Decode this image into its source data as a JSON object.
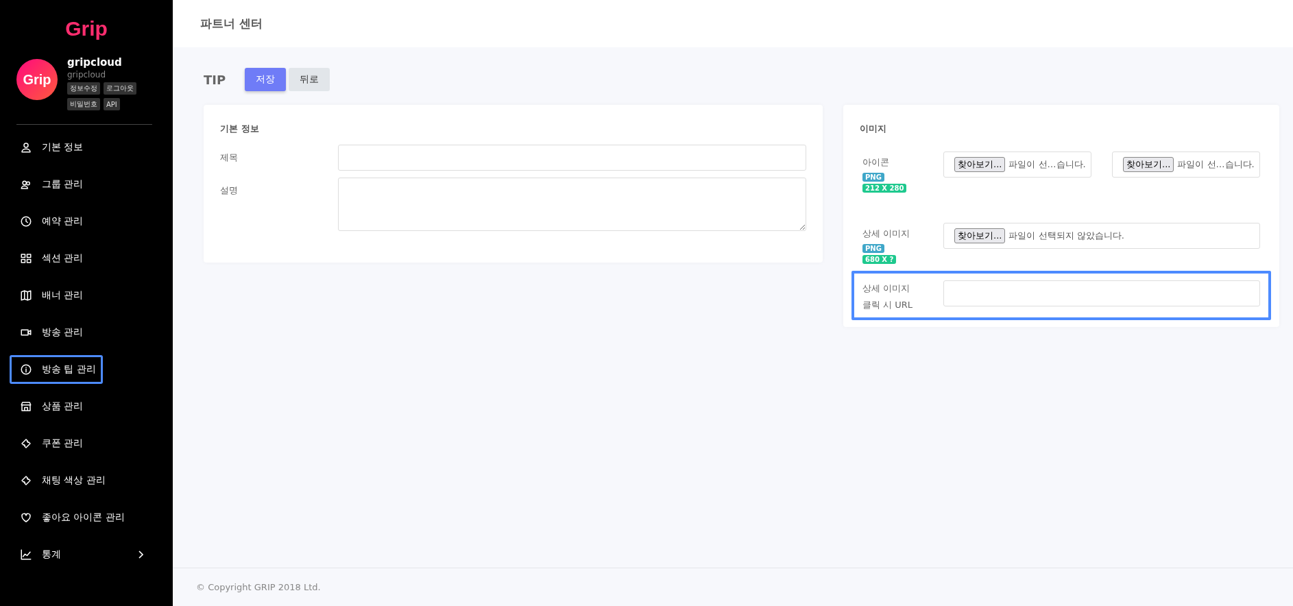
{
  "sidebar": {
    "logo": "Grip",
    "profile": {
      "avatar_text": "Grip",
      "name": "gripcloud",
      "id": "gripcloud",
      "buttons": [
        "정보수정",
        "로그아웃",
        "비밀번호",
        "API"
      ]
    },
    "items": [
      {
        "label": "기본 정보",
        "selected": false
      },
      {
        "label": "그룹 관리",
        "selected": false
      },
      {
        "label": "예약 관리",
        "selected": false
      },
      {
        "label": "섹션 관리",
        "selected": false
      },
      {
        "label": "배너 관리",
        "selected": false
      },
      {
        "label": "방송 관리",
        "selected": false
      },
      {
        "label": "방송 팁 관리",
        "selected": true
      },
      {
        "label": "상품 관리",
        "selected": false
      },
      {
        "label": "쿠폰 관리",
        "selected": false
      },
      {
        "label": "채팅 색상 관리",
        "selected": false
      },
      {
        "label": "좋아요 아이콘 관리",
        "selected": false
      },
      {
        "label": "통계",
        "selected": false,
        "expandable": true
      }
    ]
  },
  "header": {
    "title": "파트너 센터"
  },
  "toolbar": {
    "title": "TIP",
    "buttons": [
      {
        "label": "저장",
        "kind": "primary"
      },
      {
        "label": "뒤로",
        "kind": "secondary"
      }
    ]
  },
  "basic_card": {
    "title": "기본 정보",
    "fields": [
      {
        "label": "제목",
        "kind": "text"
      },
      {
        "label": "설명",
        "kind": "textarea"
      }
    ]
  },
  "image_card": {
    "title": "이미지",
    "rows": [
      {
        "label": "아이콘",
        "tags": [
          {
            "text": "PNG",
            "color": "#3fa7c9"
          },
          {
            "text": "212 X 280",
            "color": "#1ec98e"
          }
        ],
        "files": [
          {
            "button": "찾아보기...",
            "status": "파일이 선…습니다."
          },
          {
            "button": "찾아보기...",
            "status": "파일이 선…습니다."
          }
        ]
      },
      {
        "label": "상세 이미지",
        "tags": [
          {
            "text": "PNG",
            "color": "#3fa7c9"
          },
          {
            "text": "680 X ?",
            "color": "#1ec98e"
          }
        ],
        "files": [
          {
            "button": "찾아보기...",
            "status": "파일이 선택되지 않았습니다."
          }
        ]
      },
      {
        "label": "상세 이미지\n클릭 시 URL",
        "kind": "url",
        "highlighted": true
      }
    ]
  },
  "footer": {
    "text": "© Copyright GRIP 2018 Ltd."
  }
}
